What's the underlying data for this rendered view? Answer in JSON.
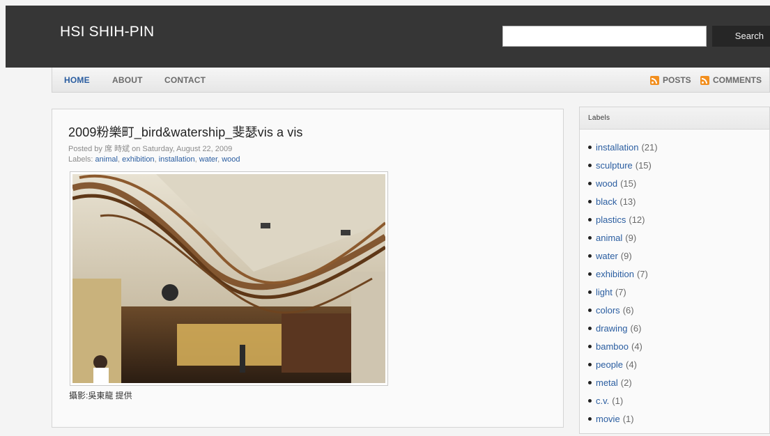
{
  "header": {
    "site_title": "HSI SHIH-PIN",
    "search_button": "Search",
    "search_value": ""
  },
  "nav": {
    "items": [
      {
        "label": "HOME",
        "active": true
      },
      {
        "label": "ABOUT",
        "active": false
      },
      {
        "label": "CONTACT",
        "active": false
      }
    ],
    "feeds": [
      {
        "label": "POSTS",
        "icon": "rss-icon"
      },
      {
        "label": "COMMENTS",
        "icon": "rss-icon"
      }
    ]
  },
  "post": {
    "title": "2009粉樂町_bird&watership_斐瑟vis a vis",
    "meta_prefix": "Posted by",
    "author": "席 時斌",
    "meta_on": "on",
    "date": "Saturday, August 22, 2009",
    "labels_prefix": "Labels:",
    "labels": [
      "animal",
      "exhibition",
      "installation",
      "water",
      "wood"
    ],
    "caption": "攝影:吳東龍 提供"
  },
  "sidebar": {
    "title": "Labels",
    "labels": [
      {
        "name": "installation",
        "count": "(21)"
      },
      {
        "name": "sculpture",
        "count": "(15)"
      },
      {
        "name": "wood",
        "count": "(15)"
      },
      {
        "name": "black",
        "count": "(13)"
      },
      {
        "name": "plastics",
        "count": "(12)"
      },
      {
        "name": "animal",
        "count": "(9)"
      },
      {
        "name": "water",
        "count": "(9)"
      },
      {
        "name": "exhibition",
        "count": "(7)"
      },
      {
        "name": "light",
        "count": "(7)"
      },
      {
        "name": "colors",
        "count": "(6)"
      },
      {
        "name": "drawing",
        "count": "(6)"
      },
      {
        "name": "bamboo",
        "count": "(4)"
      },
      {
        "name": "people",
        "count": "(4)"
      },
      {
        "name": "metal",
        "count": "(2)"
      },
      {
        "name": "c.v.",
        "count": "(1)"
      },
      {
        "name": "movie",
        "count": "(1)"
      }
    ]
  },
  "colors": {
    "header_bg": "#363636",
    "link": "#2a5da0",
    "rss": "#f28f1f"
  }
}
